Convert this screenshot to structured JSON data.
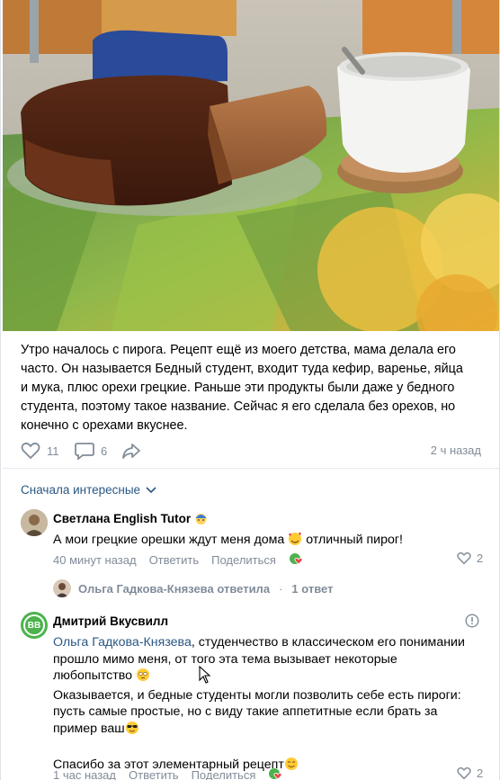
{
  "post": {
    "text": "Утро началось с пирога. Рецепт ещё из моего детства, мама делала его часто. Он называется Бедный студент, входит туда кефир, варенье, яйца и мука, плюс орехи грецкие. Раньше эти продукты были даже у бедного студента, поэтому такое название. Сейчас я его сделала без орехов, но конечно с орехами вкуснее.",
    "likes": "11",
    "comments": "6",
    "time": "2 ч назад"
  },
  "sort_label": "Сначала интересные",
  "comments": [
    {
      "author": "Светлана English Tutor",
      "text": "А мои грецкие орешки ждут меня дома",
      "text_after": " отличный пирог!",
      "time": "40 минут назад",
      "reply": "Ответить",
      "share": "Поделиться",
      "likes": "2",
      "reply_row": {
        "who": "Ольга Гадкова-Князева ответила",
        "dot": "·",
        "count": "1 ответ"
      }
    },
    {
      "author": "Дмитрий Вкусвилл",
      "avatar_text": "BB",
      "mention": "Ольга Гадкова-Князева",
      "line1_rest": ", студенчество в классическом его понимании",
      "line2": "прошло мимо меня, от того эта тема вызывает некоторые",
      "line3": "любопытство",
      "line4": "Оказывается, и бедные студенты могли позволить себе есть пироги:",
      "line5": "пусть самые простые, но с виду такие аппетитные если брать за",
      "line6": "пример ваш",
      "line7": "Спасибо за этот элементарный рецепт",
      "time": "1 час назад",
      "reply": "Ответить",
      "share": "Поделиться",
      "likes": "2"
    }
  ],
  "colors": {
    "link": "#2a5885",
    "meta": "#818c99",
    "brand_green": "#4bb34b"
  }
}
